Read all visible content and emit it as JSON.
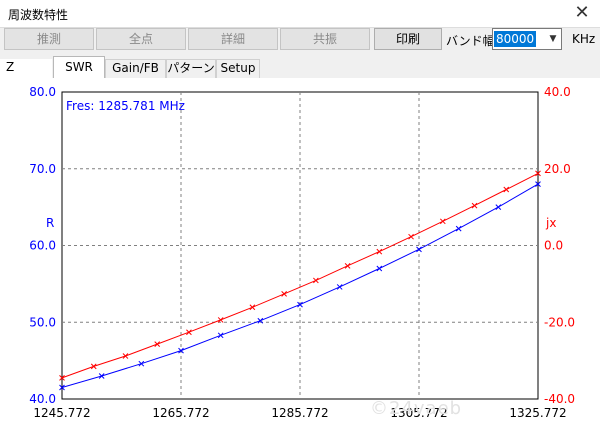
{
  "window": {
    "title": "周波数特性",
    "close_icon": "close-icon"
  },
  "toolbar": {
    "buttons": [
      {
        "label": "推測",
        "enabled": false
      },
      {
        "label": "全点",
        "enabled": false
      },
      {
        "label": "詳細",
        "enabled": false
      },
      {
        "label": "共振",
        "enabled": false
      },
      {
        "label": "印刷",
        "enabled": true
      }
    ],
    "band_label": "バンド幅",
    "band_value": "80000",
    "band_unit": "KHz"
  },
  "tabs": [
    {
      "label": "Z",
      "active": false
    },
    {
      "label": "SWR",
      "active": true
    },
    {
      "label": "Gain/FB",
      "active": false
    },
    {
      "label": "パターン",
      "active": false
    },
    {
      "label": "Setup",
      "active": false
    }
  ],
  "colors": {
    "r_series": "#0000ff",
    "jx_series": "#ff0000",
    "grid": "#808080"
  },
  "chart_data": {
    "type": "line",
    "annotation": "Fres: 1285.781 MHz",
    "left_axis_label": "R",
    "right_axis_label": "jx",
    "x_ticks": [
      "1245.772",
      "1265.772",
      "1285.772",
      "1305.772",
      "1325.772"
    ],
    "xlim": [
      1245.772,
      1325.772
    ],
    "y_left_ticks": [
      "80.0",
      "70.0",
      "60.0",
      "50.0",
      "40.0"
    ],
    "y_left_lim": [
      40,
      80
    ],
    "y_right_ticks": [
      "40.0",
      "20.0",
      "0.0",
      "-20.0",
      "-40.0"
    ],
    "y_right_lim": [
      -40,
      40
    ],
    "x": [
      1245.772,
      1253.772,
      1261.772,
      1269.772,
      1277.772,
      1285.772,
      1293.772,
      1301.772,
      1309.772,
      1317.772,
      1325.772
    ],
    "series": [
      {
        "axis": "left",
        "values": [
          41.5,
          43.0,
          44.6,
          46.3,
          48.3,
          50.2,
          52.3,
          54.6,
          57.0,
          59.5,
          62.2,
          65.0,
          68.0
        ]
      },
      {
        "axis": "right",
        "values": [
          -34.5,
          -31.5,
          -28.8,
          -25.7,
          -22.6,
          -19.4,
          -16.1,
          -12.6,
          -9.1,
          -5.3,
          -1.6,
          2.3,
          6.3,
          10.4,
          14.6,
          18.8
        ]
      }
    ]
  },
  "watermark": "©24vaeb"
}
